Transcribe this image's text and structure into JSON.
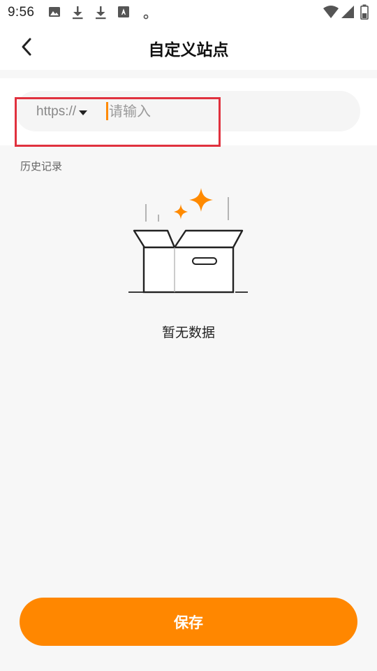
{
  "status_bar": {
    "time": "9:56",
    "icons": [
      "image-icon",
      "download-icon",
      "download-icon",
      "font-icon",
      "dot-icon",
      "wifi-icon",
      "signal-icon",
      "battery-icon"
    ]
  },
  "header": {
    "title": "自定义站点",
    "back_icon": "chevron-left-icon"
  },
  "url_input": {
    "protocol": "https://",
    "placeholder": "请输入",
    "value": ""
  },
  "history": {
    "label": "历史记录",
    "items": []
  },
  "empty_state": {
    "text": "暂无数据",
    "icon": "empty-box-icon"
  },
  "footer": {
    "save_label": "保存"
  },
  "colors": {
    "accent": "#ff8700",
    "highlight": "#e0313e",
    "background": "#f7f7f7"
  }
}
